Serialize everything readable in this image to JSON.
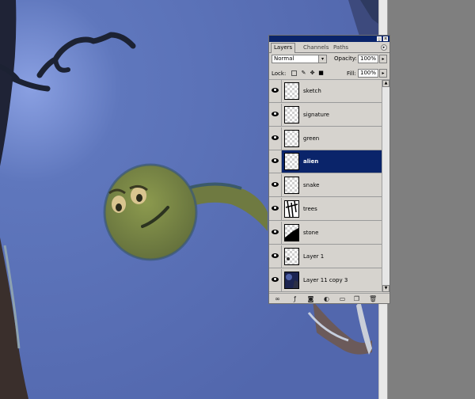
{
  "panel": {
    "tabs": [
      "Layers",
      "Channels",
      "Paths"
    ],
    "blend_mode": "Normal",
    "opacity_label": "Opacity:",
    "opacity_value": "100%",
    "lock_label": "Lock:",
    "fill_label": "Fill:",
    "fill_value": "100%"
  },
  "layers": [
    {
      "name": "sketch",
      "selected": false
    },
    {
      "name": "signature",
      "selected": false
    },
    {
      "name": "green",
      "selected": false
    },
    {
      "name": "alien",
      "selected": true
    },
    {
      "name": "snake",
      "selected": false
    },
    {
      "name": "trees",
      "selected": false
    },
    {
      "name": "stone",
      "selected": false
    },
    {
      "name": "Layer 1",
      "selected": false
    },
    {
      "name": "Layer 11 copy 3",
      "selected": false
    }
  ],
  "colors": {
    "selection": "#0a246a",
    "panel_bg": "#d6d3ce",
    "canvas_bg": "#5d74b8"
  },
  "icons": {
    "visibility": "eye-icon",
    "bottom_bar": [
      "link-icon",
      "layer-style-icon",
      "mask-icon",
      "adjustment-icon",
      "new-group-icon",
      "new-layer-icon",
      "trash-icon"
    ]
  }
}
